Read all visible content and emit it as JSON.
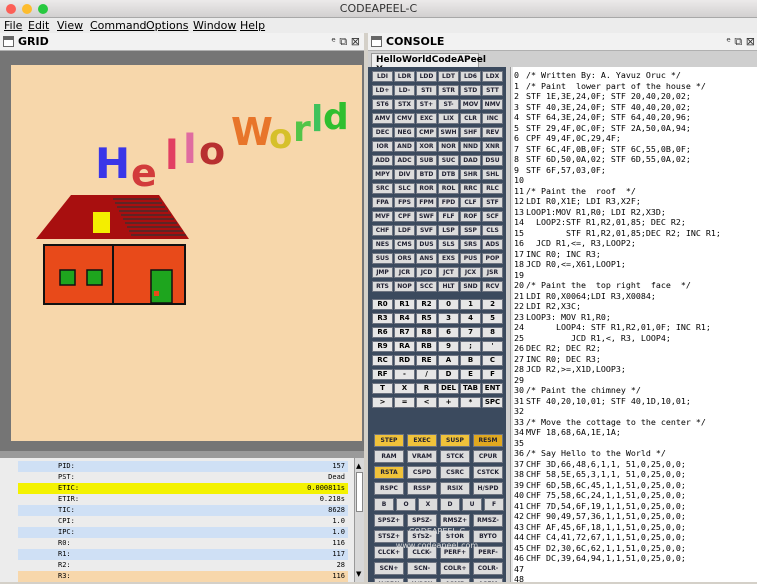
{
  "window": {
    "title": "CODEAPEEL-C",
    "traffic_colors": [
      "#fc5f57",
      "#fdbc2e",
      "#28c940"
    ]
  },
  "menu": [
    "File",
    "Edit",
    "View",
    "Command",
    "Options",
    "Window",
    "Help"
  ],
  "grid_pane": {
    "title": "GRID",
    "controls": "ᵉ ⧉ ⊠"
  },
  "console_pane": {
    "title": "CONSOLE",
    "controls": "ᵉ ⧉ ⊠",
    "tab": "HelloWorldCodeAPeel  X"
  },
  "canvas": {
    "hello": [
      "H",
      "e",
      "l",
      "l",
      "o"
    ],
    "world": [
      "W",
      "o",
      "r",
      "l",
      "d"
    ],
    "hello_colors": [
      "#3a36e8",
      "#d23b3b",
      "#e23f62",
      "#e06ca0",
      "#b83030"
    ],
    "world_colors": [
      "#e8752a",
      "#d6c02b",
      "#52c548",
      "#3fc25c",
      "#2fbf2f"
    ]
  },
  "registers": [
    {
      "k": "PID:",
      "v": "157",
      "bg": "#cfe0f5"
    },
    {
      "k": "PST:",
      "v": "Dead",
      "bg": "#ececec"
    },
    {
      "k": "ETIC:",
      "v": "0.000811s",
      "bg": "#f4f200"
    },
    {
      "k": "ETIR:",
      "v": "0.218s",
      "bg": "#ececec"
    },
    {
      "k": "TIC:",
      "v": "8628",
      "bg": "#cfe0f5"
    },
    {
      "k": "CPI:",
      "v": "1.0",
      "bg": "#ececec"
    },
    {
      "k": "IPC:",
      "v": "1.0",
      "bg": "#cfe0f5"
    },
    {
      "k": "R0:",
      "v": "116",
      "bg": "#ececec"
    },
    {
      "k": "R1:",
      "v": "117",
      "bg": "#cfe0f5"
    },
    {
      "k": "R2:",
      "v": "28",
      "bg": "#ececec"
    },
    {
      "k": "R3:",
      "v": "116",
      "bg": "#f7d7ab"
    }
  ],
  "opcodes": [
    [
      "LDI",
      "LDR",
      "LDD",
      "LDT",
      "LD6",
      "LDX"
    ],
    [
      "LD+",
      "LD-",
      "STI",
      "STR",
      "STD",
      "STT"
    ],
    [
      "ST6",
      "STX",
      "ST+",
      "ST-",
      "MOV",
      "NMV"
    ],
    [
      "AMV",
      "CMV",
      "EXC",
      "LIX",
      "CLR",
      "INC"
    ],
    [
      "DEC",
      "NEG",
      "CMP",
      "SWH",
      "SHF",
      "REV"
    ],
    [
      "IOR",
      "AND",
      "XOR",
      "NOR",
      "NND",
      "XNR"
    ],
    [
      "ADD",
      "ADC",
      "SUB",
      "SUC",
      "DAD",
      "DSU"
    ],
    [
      "MPY",
      "DIV",
      "BTD",
      "DTB",
      "SHR",
      "SHL"
    ],
    [
      "SRC",
      "SLC",
      "ROR",
      "ROL",
      "RRC",
      "RLC"
    ],
    [
      "FPA",
      "FPS",
      "FPM",
      "FPD",
      "CLF",
      "STF"
    ],
    [
      "MVF",
      "CPF",
      "SWF",
      "FLF",
      "ROF",
      "SCF"
    ],
    [
      "CHF",
      "LDF",
      "SVF",
      "LSP",
      "SSP",
      "CLS"
    ],
    [
      "NES",
      "CMS",
      "DUS",
      "SLS",
      "SRS",
      "ADS"
    ],
    [
      "SUS",
      "ORS",
      "ANS",
      "EXS",
      "PUS",
      "POP"
    ],
    [
      "JMP",
      "JCR",
      "JCD",
      "JCT",
      "JCX",
      "JSR"
    ],
    [
      "RTS",
      "NOP",
      "SCC",
      "HLT",
      "SND",
      "RCV"
    ]
  ],
  "regkeys": [
    [
      "R0",
      "R1",
      "R2",
      "0",
      "1",
      "2"
    ],
    [
      "R3",
      "R4",
      "R5",
      "3",
      "4",
      "5"
    ],
    [
      "R6",
      "R7",
      "R8",
      "6",
      "7",
      "8"
    ],
    [
      "R9",
      "RA",
      "RB",
      "9",
      ";",
      "'"
    ],
    [
      "RC",
      "RD",
      "RE",
      "A",
      "B",
      "C"
    ],
    [
      "RF",
      "-",
      "/",
      "D",
      "E",
      "F"
    ],
    [
      "T",
      "X",
      "R",
      "DEL",
      "TAB",
      "ENT"
    ],
    [
      ">",
      "=",
      "<",
      "+",
      "*",
      "SPC"
    ]
  ],
  "ctlkeys": [
    [
      "STEP",
      "EXEC",
      "SUSP",
      "RESM"
    ],
    [
      "RAM",
      "VRAM",
      "STCK",
      "CPUR"
    ],
    [
      "RSTA",
      "CSPD",
      "CSRC",
      "CSTCK"
    ],
    [
      "RSPC",
      "RSSP",
      "RSIX",
      "H/SPD"
    ],
    [
      "B",
      "O",
      "X",
      "D",
      "U",
      "F"
    ],
    [
      "SPSZ+",
      "SPSZ-",
      "RMSZ+",
      "RMSZ-"
    ],
    [
      "STSZ+",
      "STSZ-",
      "STOR",
      "BYTO"
    ],
    [
      "CLCK+",
      "CLCK-",
      "PERF+",
      "PERF-"
    ],
    [
      "SCN+",
      "SCN-",
      "COLR+",
      "COLR-"
    ],
    [
      "H/SRN",
      "H/SCN",
      "ASMB",
      "ASFM"
    ]
  ],
  "brand": {
    "name": "CODEAPEEL-C",
    "url": "www.codeapeel.com"
  },
  "code": [
    "/* Written By: A. Yavuz Oruc */",
    "/* Paint  lower part of the house */",
    "STF 1E,3E,24,0F; STF 20,40,20,02;",
    "STF 40,3E,24,0F; STF 40,40,20,02;",
    "STF 64,3E,24,0F; STF 64,40,20,96;",
    "STF 29,4F,0C,0F; STF 2A,50,0A,94;",
    "CPF 49,4F,0C,29,4F;",
    "STF 6C,4F,0B,0F; STF 6C,55,0B,0F;",
    "STF 6D,50,0A,02; STF 6D,55,0A,02;",
    "STF 6F,57,03,0F;",
    "",
    "/* Paint the  roof  */",
    "LDI R0,X1E; LDI R3,X2F;",
    "LOOP1:MOV R1,R0; LDI R2,X3D;",
    "  LOOP2:STF R1,R2,01,85; DEC R2;",
    "        STF R1,R2,01,85;DEC R2; INC R1;",
    "  JCD R1,<=, R3,LOOP2;",
    "INC R0; INC R3;",
    "JCD R0,<=,X61,LOOP1;",
    "",
    "/* Paint the  top right  face  */",
    "LDI R0,X0064;LDI R3,X0084;",
    "LDI R2,X3C;",
    "LOOP3: MOV R1,R0;",
    "      LOOP4: STF R1,R2,01,0F; INC R1;",
    "         JCD R1,<, R3, LOOP4;",
    "DEC R2; DEC R2;",
    "INC R0; DEC R3;",
    "JCD R2,>=,X1D,LOOP3;",
    "",
    "/* Paint the chimney */",
    "STF 40,20,10,01; STF 40,1D,10,01;",
    "",
    "/* Move the cottage to the center */",
    "MVF 18,68,6A,1E,1A;",
    "",
    "/* Say Hello to the World */",
    "CHF 3D,66,48,6,1,1, 51,0,25,0,0;",
    "CHF 58,5E,65,3,1,1, 51,0,25,0,0;",
    "CHF 6D,5B,6C,45,1,1,51,0,25,0,0;",
    "CHF 75,58,6C,24,1,1,51,0,25,0,0;",
    "CHF 7D,54,6F,19,1,1,51,0,25,0,0;",
    "CHF 90,49,57,36,1,1,51,0,25,0,0;",
    "CHF AF,45,6F,18,1,1,51,0,25,0,0;",
    "CHF C4,41,72,67,1,1,51,0,25,0,0;",
    "CHF D2,30,6C,62,1,1,51,0,25,0,0;",
    "CHF DC,39,64,94,1,1,51,0,25,0,0;",
    "",
    ""
  ]
}
